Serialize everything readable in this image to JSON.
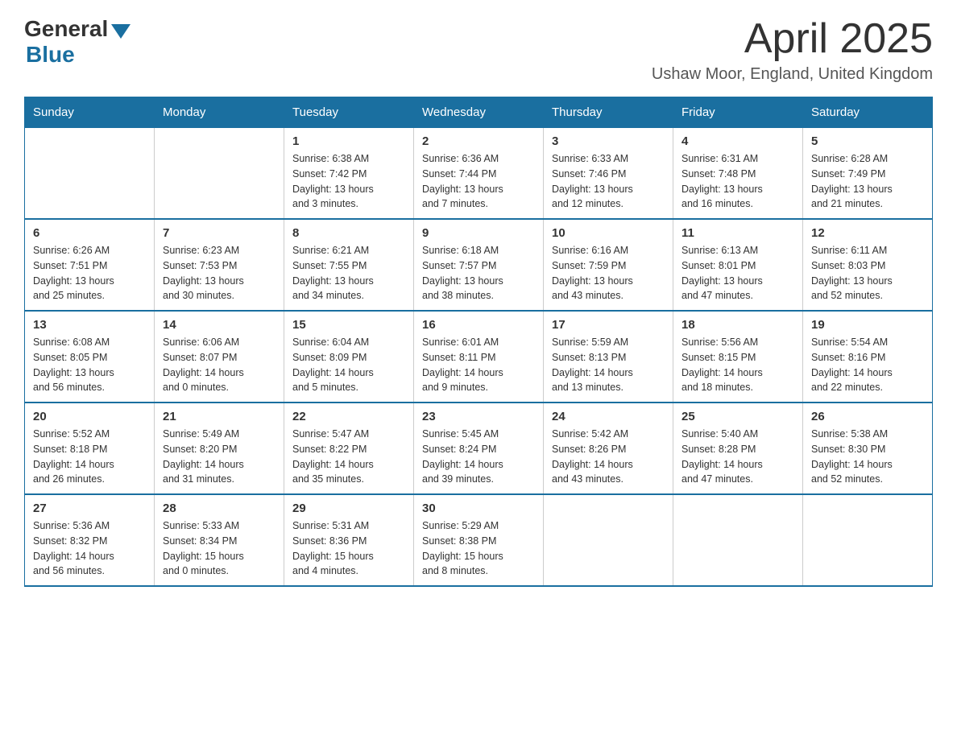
{
  "logo": {
    "general": "General",
    "blue": "Blue"
  },
  "title": "April 2025",
  "location": "Ushaw Moor, England, United Kingdom",
  "weekdays": [
    "Sunday",
    "Monday",
    "Tuesday",
    "Wednesday",
    "Thursday",
    "Friday",
    "Saturday"
  ],
  "weeks": [
    [
      {
        "day": "",
        "info": ""
      },
      {
        "day": "",
        "info": ""
      },
      {
        "day": "1",
        "info": "Sunrise: 6:38 AM\nSunset: 7:42 PM\nDaylight: 13 hours\nand 3 minutes."
      },
      {
        "day": "2",
        "info": "Sunrise: 6:36 AM\nSunset: 7:44 PM\nDaylight: 13 hours\nand 7 minutes."
      },
      {
        "day": "3",
        "info": "Sunrise: 6:33 AM\nSunset: 7:46 PM\nDaylight: 13 hours\nand 12 minutes."
      },
      {
        "day": "4",
        "info": "Sunrise: 6:31 AM\nSunset: 7:48 PM\nDaylight: 13 hours\nand 16 minutes."
      },
      {
        "day": "5",
        "info": "Sunrise: 6:28 AM\nSunset: 7:49 PM\nDaylight: 13 hours\nand 21 minutes."
      }
    ],
    [
      {
        "day": "6",
        "info": "Sunrise: 6:26 AM\nSunset: 7:51 PM\nDaylight: 13 hours\nand 25 minutes."
      },
      {
        "day": "7",
        "info": "Sunrise: 6:23 AM\nSunset: 7:53 PM\nDaylight: 13 hours\nand 30 minutes."
      },
      {
        "day": "8",
        "info": "Sunrise: 6:21 AM\nSunset: 7:55 PM\nDaylight: 13 hours\nand 34 minutes."
      },
      {
        "day": "9",
        "info": "Sunrise: 6:18 AM\nSunset: 7:57 PM\nDaylight: 13 hours\nand 38 minutes."
      },
      {
        "day": "10",
        "info": "Sunrise: 6:16 AM\nSunset: 7:59 PM\nDaylight: 13 hours\nand 43 minutes."
      },
      {
        "day": "11",
        "info": "Sunrise: 6:13 AM\nSunset: 8:01 PM\nDaylight: 13 hours\nand 47 minutes."
      },
      {
        "day": "12",
        "info": "Sunrise: 6:11 AM\nSunset: 8:03 PM\nDaylight: 13 hours\nand 52 minutes."
      }
    ],
    [
      {
        "day": "13",
        "info": "Sunrise: 6:08 AM\nSunset: 8:05 PM\nDaylight: 13 hours\nand 56 minutes."
      },
      {
        "day": "14",
        "info": "Sunrise: 6:06 AM\nSunset: 8:07 PM\nDaylight: 14 hours\nand 0 minutes."
      },
      {
        "day": "15",
        "info": "Sunrise: 6:04 AM\nSunset: 8:09 PM\nDaylight: 14 hours\nand 5 minutes."
      },
      {
        "day": "16",
        "info": "Sunrise: 6:01 AM\nSunset: 8:11 PM\nDaylight: 14 hours\nand 9 minutes."
      },
      {
        "day": "17",
        "info": "Sunrise: 5:59 AM\nSunset: 8:13 PM\nDaylight: 14 hours\nand 13 minutes."
      },
      {
        "day": "18",
        "info": "Sunrise: 5:56 AM\nSunset: 8:15 PM\nDaylight: 14 hours\nand 18 minutes."
      },
      {
        "day": "19",
        "info": "Sunrise: 5:54 AM\nSunset: 8:16 PM\nDaylight: 14 hours\nand 22 minutes."
      }
    ],
    [
      {
        "day": "20",
        "info": "Sunrise: 5:52 AM\nSunset: 8:18 PM\nDaylight: 14 hours\nand 26 minutes."
      },
      {
        "day": "21",
        "info": "Sunrise: 5:49 AM\nSunset: 8:20 PM\nDaylight: 14 hours\nand 31 minutes."
      },
      {
        "day": "22",
        "info": "Sunrise: 5:47 AM\nSunset: 8:22 PM\nDaylight: 14 hours\nand 35 minutes."
      },
      {
        "day": "23",
        "info": "Sunrise: 5:45 AM\nSunset: 8:24 PM\nDaylight: 14 hours\nand 39 minutes."
      },
      {
        "day": "24",
        "info": "Sunrise: 5:42 AM\nSunset: 8:26 PM\nDaylight: 14 hours\nand 43 minutes."
      },
      {
        "day": "25",
        "info": "Sunrise: 5:40 AM\nSunset: 8:28 PM\nDaylight: 14 hours\nand 47 minutes."
      },
      {
        "day": "26",
        "info": "Sunrise: 5:38 AM\nSunset: 8:30 PM\nDaylight: 14 hours\nand 52 minutes."
      }
    ],
    [
      {
        "day": "27",
        "info": "Sunrise: 5:36 AM\nSunset: 8:32 PM\nDaylight: 14 hours\nand 56 minutes."
      },
      {
        "day": "28",
        "info": "Sunrise: 5:33 AM\nSunset: 8:34 PM\nDaylight: 15 hours\nand 0 minutes."
      },
      {
        "day": "29",
        "info": "Sunrise: 5:31 AM\nSunset: 8:36 PM\nDaylight: 15 hours\nand 4 minutes."
      },
      {
        "day": "30",
        "info": "Sunrise: 5:29 AM\nSunset: 8:38 PM\nDaylight: 15 hours\nand 8 minutes."
      },
      {
        "day": "",
        "info": ""
      },
      {
        "day": "",
        "info": ""
      },
      {
        "day": "",
        "info": ""
      }
    ]
  ]
}
